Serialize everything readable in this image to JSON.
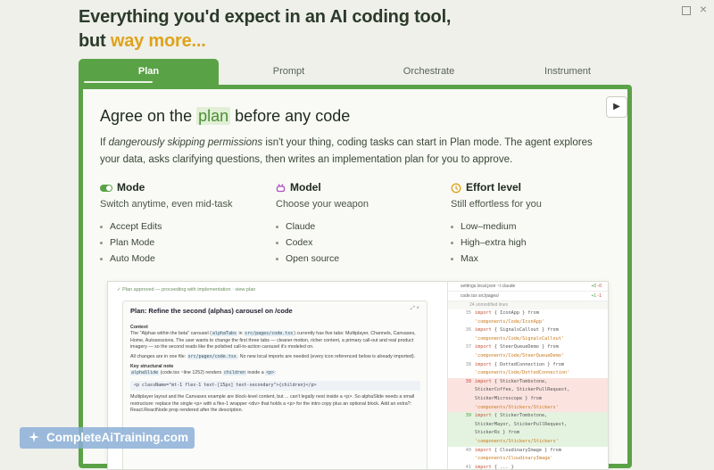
{
  "window": {
    "maximize_label": "",
    "close_label": "×"
  },
  "headline": {
    "line1": "Everything you'd expect in an AI coding tool,",
    "line2_prefix": "but ",
    "line2_accent": "way more..."
  },
  "tabs": [
    {
      "label": "Plan"
    },
    {
      "label": "Prompt"
    },
    {
      "label": "Orchestrate"
    },
    {
      "label": "Instrument"
    }
  ],
  "card": {
    "play_icon": "▶",
    "title_prefix": "Agree on the ",
    "title_highlight": "plan",
    "title_suffix": " before any code",
    "desc_prefix": "If ",
    "desc_italic": "dangerously skipping permissions",
    "desc_rest": " isn't your thing, coding tasks can start in Plan mode. The agent explores your data, asks clarifying questions, then writes an implementation plan for you to approve."
  },
  "columns": [
    {
      "title": "Mode",
      "subtitle": "Switch anytime, even mid-task",
      "items": [
        "Accept Edits",
        "Plan Mode",
        "Auto Mode"
      ],
      "icon_color": "#5aa246"
    },
    {
      "title": "Model",
      "subtitle": "Choose your weapon",
      "items": [
        "Claude",
        "Codex",
        "Open source"
      ],
      "icon_color": "#b04fc4"
    },
    {
      "title": "Effort level",
      "subtitle": "Still effortless for you",
      "items": [
        "Low–medium",
        "High–extra high",
        "Max"
      ],
      "icon_color": "#e0a21a"
    }
  ],
  "screenshot": {
    "status": "✓  Plan approved — proceeding with implementation · view plan",
    "plan_title": "Plan: Refine the second (alphas) carousel on /code",
    "plan_icons": "⤢ ×",
    "context_h": "Context",
    "context_1": "The \"Alphas within the beta\" carousel (",
    "context_code": "alphaTabs",
    "context_2": " in ",
    "context_code2": "src/pages/code.tsx",
    "context_3": ") currently has five tabs: Multiplayer, Channels, Canvases, Home, Autosessions. The user wants to change the first three tabs — cleaner motion, richer content, a primary call-out and real product imagery — so the second reads like the polished call-to-action carousel it's modeled on.",
    "changes_1": "All changes are in one file: ",
    "changes_code": "src/pages/code.tsx",
    "changes_2": ". No new local imports are needed (every icon referenced below is already imported).",
    "struct_h": "Key structural note",
    "struct_code": "alphaSlide",
    "struct_1": " (code.tsx ~line 1252) renders ",
    "struct_code2": "children",
    "struct_2": " inside a ",
    "struct_code3": "<p>",
    "struct_3": ":",
    "code_line": "<p className=\"mt-1 flex-1 text-[15px] text-secondary\">{children}</p>",
    "note": "Multiplayer layout and the Canvases example are block-level content, but ... can't legally nest inside a <p>. So alphaSlide needs a small restructure: replace the single <p> with a flex-1 wrapper <div> that holds a <p> for the intro copy plus an optional block. Add an extra?: React.ReactNode prop rendered after the description.",
    "diff_tabs": [
      {
        "label": "settings.local.json   ~/.claude",
        "plus": "+0",
        "minus": "-0"
      },
      {
        "label": "code.tsx   src/pages/",
        "plus": "+1",
        "minus": "-1"
      }
    ],
    "diff_unmod": "24 unmodified lines",
    "diff_lines": [
      {
        "n": "35",
        "kw": "import",
        "code": " { IconApp } from",
        "kind": "ctx"
      },
      {
        "n": "",
        "kw": "",
        "code": "  'components/Code/IconApp'",
        "kind": "ctx"
      },
      {
        "n": "36",
        "kw": "import",
        "code": " { SignalsCallout } from",
        "kind": "ctx"
      },
      {
        "n": "",
        "kw": "",
        "code": "  'components/Code/SignalsCallout'",
        "kind": "ctx"
      },
      {
        "n": "37",
        "kw": "import",
        "code": " { SteerQueueDemo } from",
        "kind": "ctx"
      },
      {
        "n": "",
        "kw": "",
        "code": "  'components/Code/SteerQueueDemo'",
        "kind": "ctx"
      },
      {
        "n": "38",
        "kw": "import",
        "code": " { DottedConnection } from",
        "kind": "ctx"
      },
      {
        "n": "",
        "kw": "",
        "code": "  'components/Code/DottedConnection'",
        "kind": "ctx"
      },
      {
        "n": "39",
        "kw": "import",
        "code": " { StickerTombstone,",
        "kind": "del"
      },
      {
        "n": "",
        "kw": "",
        "code": "  StickerCoffee, StickerPullRequest,",
        "kind": "del"
      },
      {
        "n": "",
        "kw": "",
        "code": "  StickerMicroscope } from",
        "kind": "del"
      },
      {
        "n": "",
        "kw": "",
        "code": "  'components/Stickers/Stickers'",
        "kind": "del"
      },
      {
        "n": "39",
        "kw": "import",
        "code": " { StickerTombstone,",
        "kind": "add"
      },
      {
        "n": "",
        "kw": "",
        "code": "  StickerMayor, StickerPullRequest,",
        "kind": "add"
      },
      {
        "n": "",
        "kw": "",
        "code": "  StickerRx } from",
        "kind": "add"
      },
      {
        "n": "",
        "kw": "",
        "code": "  'components/Stickers/Stickers'",
        "kind": "add"
      },
      {
        "n": "40",
        "kw": "import",
        "code": " { CloudinaryImage } from",
        "kind": "ctx"
      },
      {
        "n": "",
        "kw": "",
        "code": "  'components/CloudinaryImage'",
        "kind": "ctx"
      },
      {
        "n": "41",
        "kw": "import",
        "code": " { ... }",
        "kind": "ctx"
      }
    ]
  },
  "watermark": {
    "text": "CompleteAiTraining.com"
  }
}
